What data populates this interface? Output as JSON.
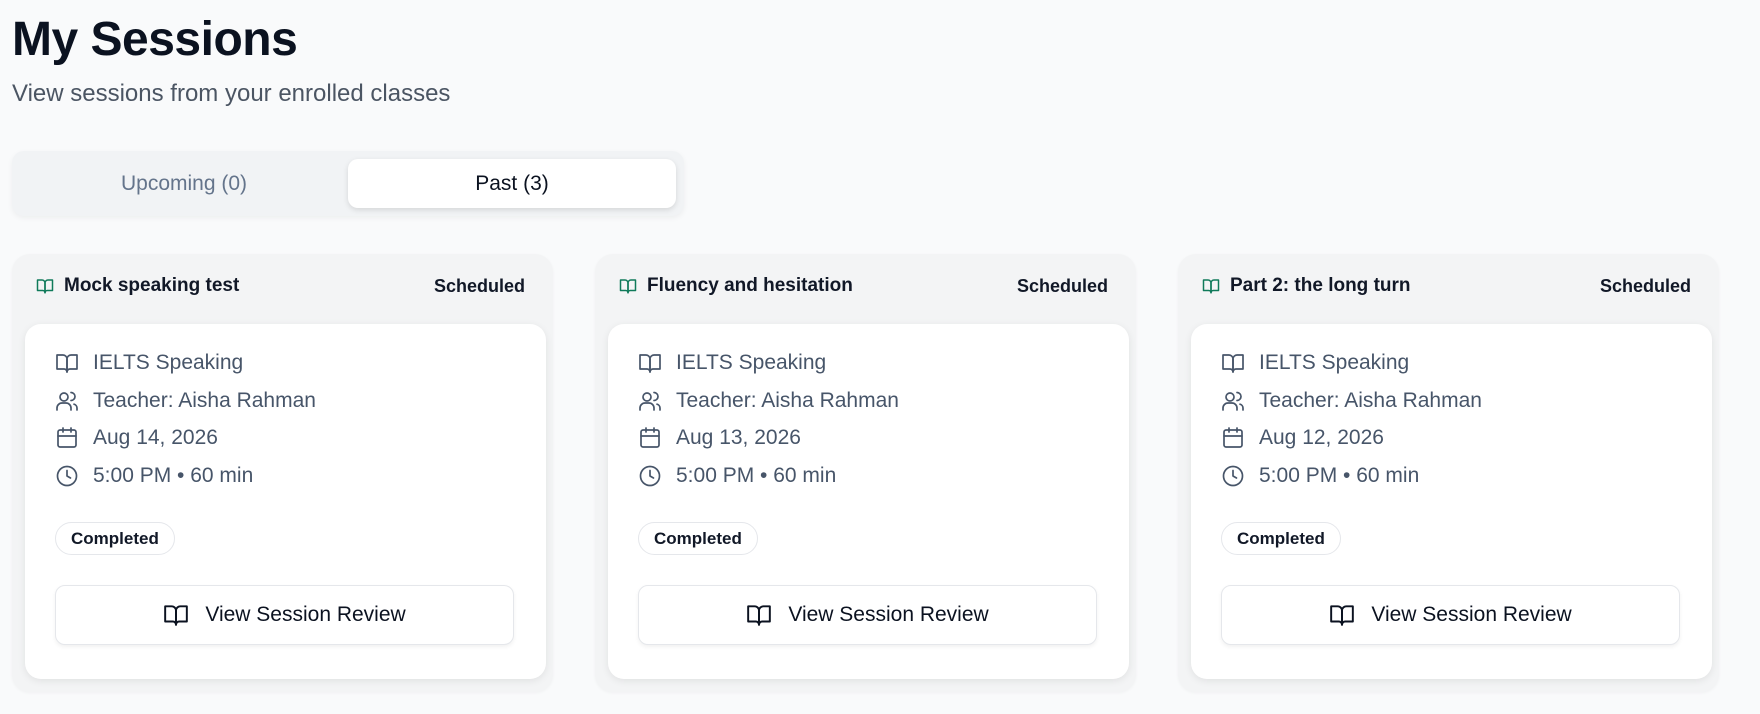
{
  "header": {
    "title": "My Sessions",
    "subtitle": "View sessions from your enrolled classes"
  },
  "tabs": [
    {
      "label": "Upcoming (0)",
      "active": false
    },
    {
      "label": "Past (3)",
      "active": true
    }
  ],
  "colors": {
    "accent_icon": "#0f7a5a",
    "muted_icon": "#475569"
  },
  "sessions": [
    {
      "title": "Mock speaking test",
      "status_badge": "Scheduled",
      "course": "IELTS Speaking",
      "teacher": "Teacher: Aisha Rahman",
      "date": "Aug 14, 2026",
      "time": "5:00 PM • 60 min",
      "state": "Completed",
      "action_label": "View Session Review"
    },
    {
      "title": "Fluency and hesitation",
      "status_badge": "Scheduled",
      "course": "IELTS Speaking",
      "teacher": "Teacher: Aisha Rahman",
      "date": "Aug 13, 2026",
      "time": "5:00 PM • 60 min",
      "state": "Completed",
      "action_label": "View Session Review"
    },
    {
      "title": "Part 2: the long turn",
      "status_badge": "Scheduled",
      "course": "IELTS Speaking",
      "teacher": "Teacher: Aisha Rahman",
      "date": "Aug 12, 2026",
      "time": "5:00 PM • 60 min",
      "state": "Completed",
      "action_label": "View Session Review"
    }
  ]
}
